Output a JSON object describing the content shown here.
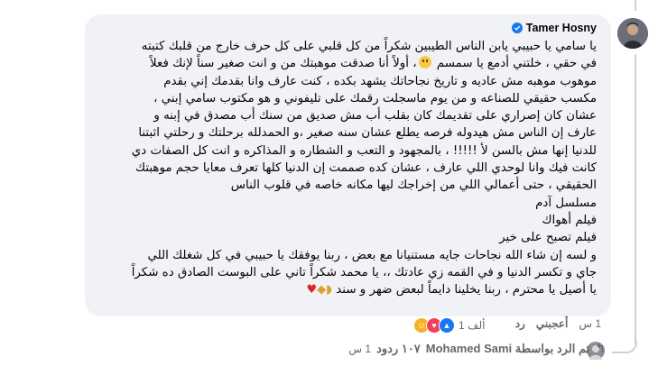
{
  "comment": {
    "author": "Tamer Hosny",
    "verified": true,
    "lines": [
      "يا سامي يا حبيبي يابن الناس الطيبين شكراً من كل قلبي على كل حرف خارج من قلبك كتبته",
      "في حقي ، خلتني أدمع يا سمسم",
      "، أولاً أنا صدقت موهبتك من و انت صغير سناً لإنك فعلاً",
      "موهوب موهبه مش عاديه و تاريخ نجاحاتك يشهد بكده ، كنت عارف وانا بقدمك إني بقدم",
      "مكسب حقيقي للصناعه و من يوم ماسجلت رقمك على تليفوني و هو مكتوب سامي إبني ،",
      "عشان كان إصراري على تقديمك كان بقلب أب مش صديق من سنك أب مصدق في إبنه و",
      "عارف إن الناس مش هيدوله فرصه يطلع عشان سنه صغير ،و الحمدلله برحلتك و رحلتي اثبتنا",
      "للدنيا إنها مش بالسن لأ !!!!! ، بالمجهود و التعب و الشطاره و المذاكره و انت كل الصفات دي",
      "كانت فيك وانا لوحدي اللي عارف ، عشان كده صممت إن الدنيا كلها تعرف معايا حجم موهبتك",
      "الحقيقي ، حتى أعمالي اللي من إخراجك ليها مكانه خاصه في قلوب الناس",
      "مسلسل آدم",
      "فيلم أهواك",
      "فيلم تصبح على خير",
      "و لسه إن شاء الله نجاحات جايه مستنيانا مع بعض ، ربنا يوفقك يا حبيبي في كل شغلك اللي",
      "جاي و تكسر الدنيا و في القمه زي عادتك ،، يا محمد شكراً تاني على البوست الصادق ده شكراً",
      "يا أصيل يا محترم ، ربنا يخلينا دايماً لبعض ضهر و سند"
    ]
  },
  "actions": {
    "like": "أعجبني",
    "reply": "رد",
    "time": "1 س"
  },
  "reactions": {
    "count": "1 ألف"
  },
  "replies": {
    "text": "تم الرد بواسطة Mohamed Sami",
    "meta": "١٠٧ ردود",
    "time": "1 س"
  },
  "icons": {
    "verified": "verified-badge-icon",
    "care": "care-reaction-icon",
    "love": "love-reaction-icon",
    "like": "like-reaction-icon",
    "reply_arrow": "reply-arrow-icon"
  },
  "colors": {
    "bubble": "#f0f2f5",
    "verified": "#1877f2",
    "secondary_text": "#65676b"
  }
}
